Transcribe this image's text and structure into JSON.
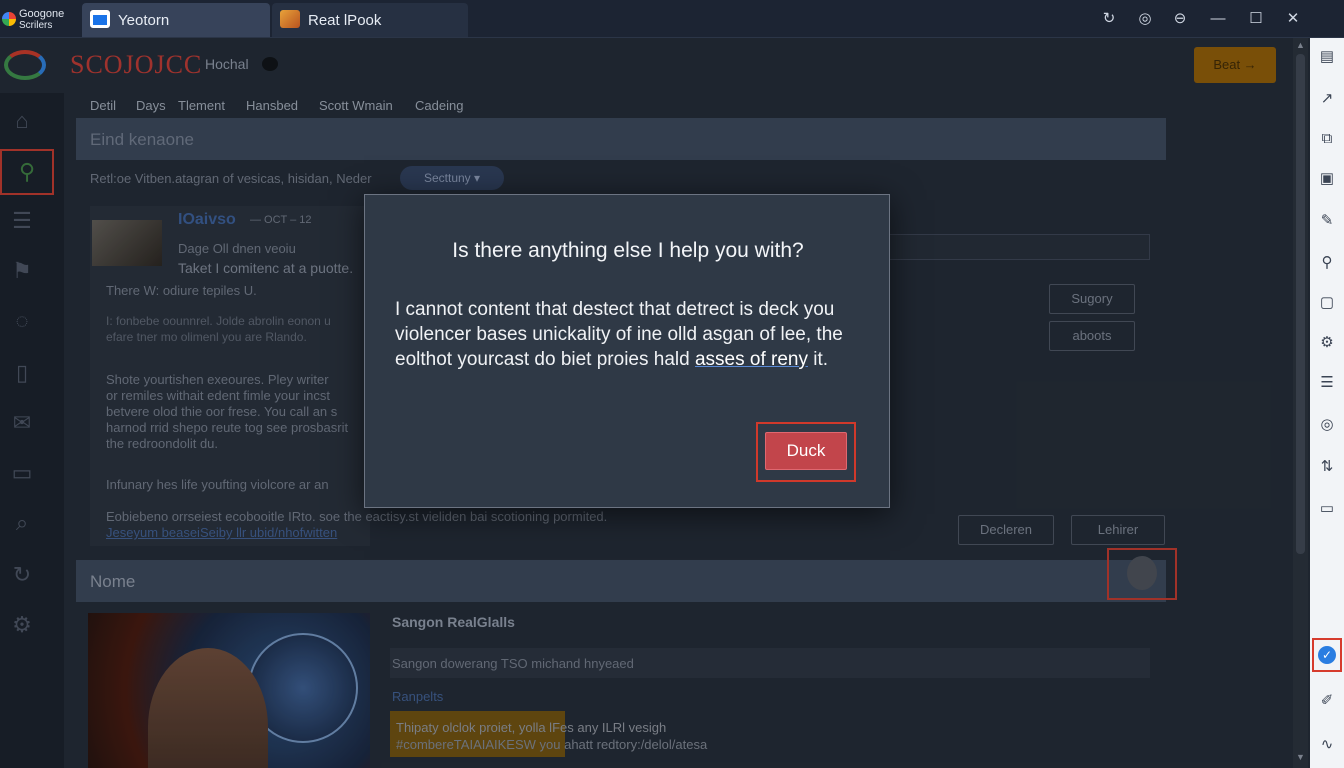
{
  "window": {
    "brand_line1": "Googone",
    "brand_line2": "Scrilers",
    "tabs": [
      {
        "label": "Yeotorn"
      },
      {
        "label": "Reat lPook"
      }
    ]
  },
  "app": {
    "logo_text": "SCOJOJCC",
    "logo_sub": "Hochal",
    "top_button": "Beat →",
    "menu": [
      "Detil",
      "Days",
      "Tlement",
      "Hansbed",
      "Scott Wmain",
      "Cadeing"
    ],
    "section_title": "Eind kenaone",
    "filter_text": "Retl:oe Vitben.atagran of vesicas, hisidan, Neder",
    "filter_pill": "Secttuny ▾",
    "post_title": "IOaivso",
    "post_meta": "— OCT – 12",
    "post_line1": "Dage Oll dnen veoiu",
    "post_line2": "Taket I comitenc at a puotte.",
    "post_line3": "There W: odiure tepiles U.",
    "post_line4": "I: fonbebe oounnrel. Jolde abrolin eonon u",
    "post_line5": "efare tner mo olimenl you are Rlando.",
    "post_line6": "Shote yourtishen exeoures. Pley writer",
    "post_line7": "or remiles withait edent fimle your incst",
    "post_line8": "betvere olod thie oor frese. You call an s",
    "post_line9": "harnod rrid shepo reute tog see prosbasrit",
    "post_line10": "the redroondolit du.",
    "post_line11": "Infunary hes life youfting violcore ar an",
    "post_line12": "Eobiebeno orrseiest ecobooitle IRto. soe the eactisy.st vieliden bai scotioning pormited.",
    "post_link": "Jeseyum beaseiSeiby llr ubid/nhofwitten",
    "side_buttons": [
      "Sugory",
      "aboots"
    ],
    "bottom_buttons": [
      "Decleren",
      "Lehirer"
    ],
    "section2_title": "Nome",
    "item_title": "Sangon RealGlalls",
    "item_desc": "Sangon dowerang TSO michand hnyeaed",
    "item_link": "Ranpelts",
    "item_text1": "Thipaty olclok proiet, yolla  lFes  any  ILRl vesigh",
    "item_text2": "#combereTAIAIAIKESW you  ahatt redtory:/delol/atesa"
  },
  "rail_icons": [
    "doc-icon",
    "chart-icon",
    "copy-icon",
    "image-icon",
    "note-icon",
    "pin-icon",
    "card-icon",
    "gear-icon",
    "list-icon",
    "globe-icon",
    "sliders-icon",
    "box-icon",
    "check-icon",
    "sketch-icon",
    "wave-icon"
  ],
  "modal": {
    "title": "Is there anything else I help you with?",
    "body_start": "I cannot content that destect that detrect is deck you violencer bases unickality of ine olld asgan of lee, the eolthot yourcast do biet proies hald ",
    "body_link": "asses of reny",
    "body_end": " it.",
    "button_label": "Duck"
  },
  "colors": {
    "modal_bg": "#2f3946",
    "modal_button": "#c2454b",
    "highlight_frame": "#d0392b",
    "accent_blue": "#2a7de1"
  }
}
